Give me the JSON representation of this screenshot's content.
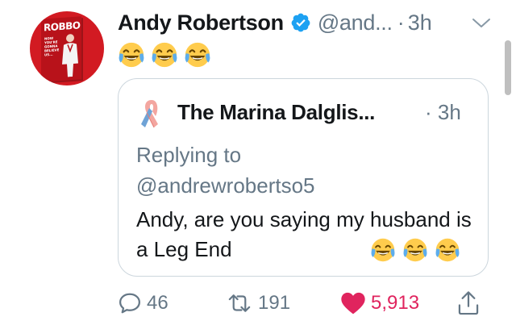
{
  "tweet": {
    "author_name": "Andy Robertson",
    "handle": "@and...",
    "separator": "·",
    "time": "3h",
    "emojis": [
      "face-with-tears-of-joy",
      "face-with-tears-of-joy",
      "face-with-tears-of-joy"
    ],
    "avatar": {
      "book_title": "ROBBO",
      "book_subtitle": "NOW YOU'RE GONNA BELIEVE US..."
    }
  },
  "quoted_tweet": {
    "author_name": "The Marina Dalglis...",
    "separator": "·",
    "time": "3h",
    "replying_to_label": "Replying to",
    "mention": "@andrewrobertso5",
    "text": "Andy, are you saying my husband is a Leg End",
    "emojis": [
      "face-with-tears-of-joy",
      "face-with-tears-of-joy",
      "face-with-tears-of-joy"
    ]
  },
  "actions": {
    "replies": "46",
    "retweets": "191",
    "likes": "5,913",
    "liked": true
  },
  "colors": {
    "text_primary": "#14171a",
    "text_secondary": "#657786",
    "verified_blue": "#1da1f2",
    "like_red": "#e0245e",
    "border": "#ccd6dd",
    "avatar_red": "#d21a22"
  }
}
